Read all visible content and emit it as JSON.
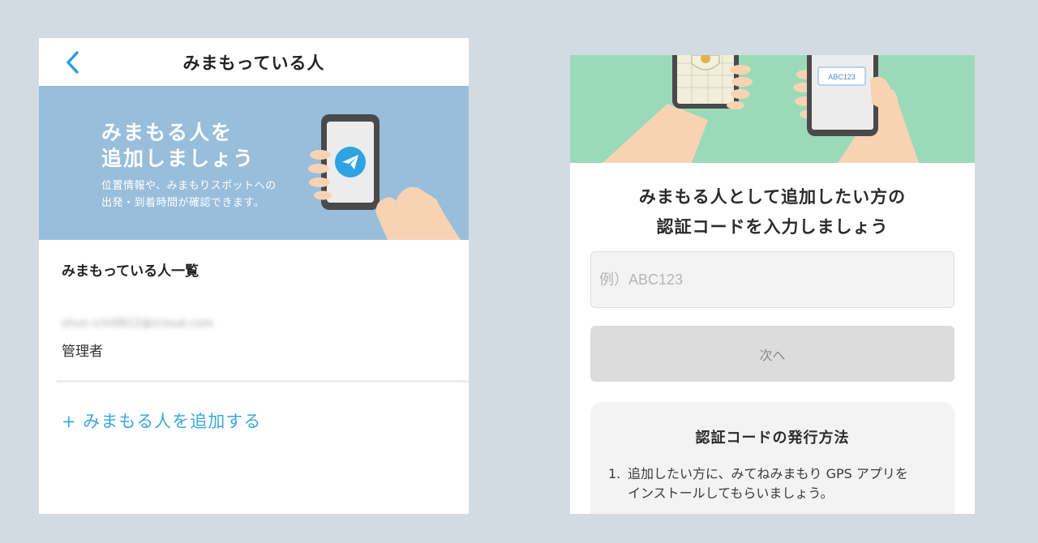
{
  "left": {
    "nav": {
      "title": "みまもっている人"
    },
    "banner": {
      "title_line1": "みまもる人を",
      "title_line2": "追加しましょう",
      "desc_line1": "位置情報や、みまもりスポットへの",
      "desc_line2": "出発・到着時間が確認できます。"
    },
    "list": {
      "heading": "みまもっている人一覧",
      "items": [
        {
          "email": "shun.ichi0812@icloud.com",
          "role": "管理者"
        }
      ]
    },
    "add_link": "+ みまもる人を追加する"
  },
  "right": {
    "hero": {
      "code_label": "ABC123"
    },
    "prompt_line1": "みまもる人として追加したい方の",
    "prompt_line2": "認証コードを入力しましょう",
    "input": {
      "placeholder": "例）ABC123",
      "value": ""
    },
    "next_button": "次へ",
    "howto": {
      "title": "認証コードの発行方法",
      "steps": [
        {
          "num": "1.",
          "line1": "追加したい方に、みてねみまもり GPS アプリを",
          "line2": "インストールしてもらいましょう。"
        }
      ]
    }
  },
  "colors": {
    "background": "#d3dbe2",
    "banner": "#98bedb",
    "hero": "#9bdab9",
    "accent": "#3aa7e0",
    "telegram": "#2ea3e1"
  }
}
